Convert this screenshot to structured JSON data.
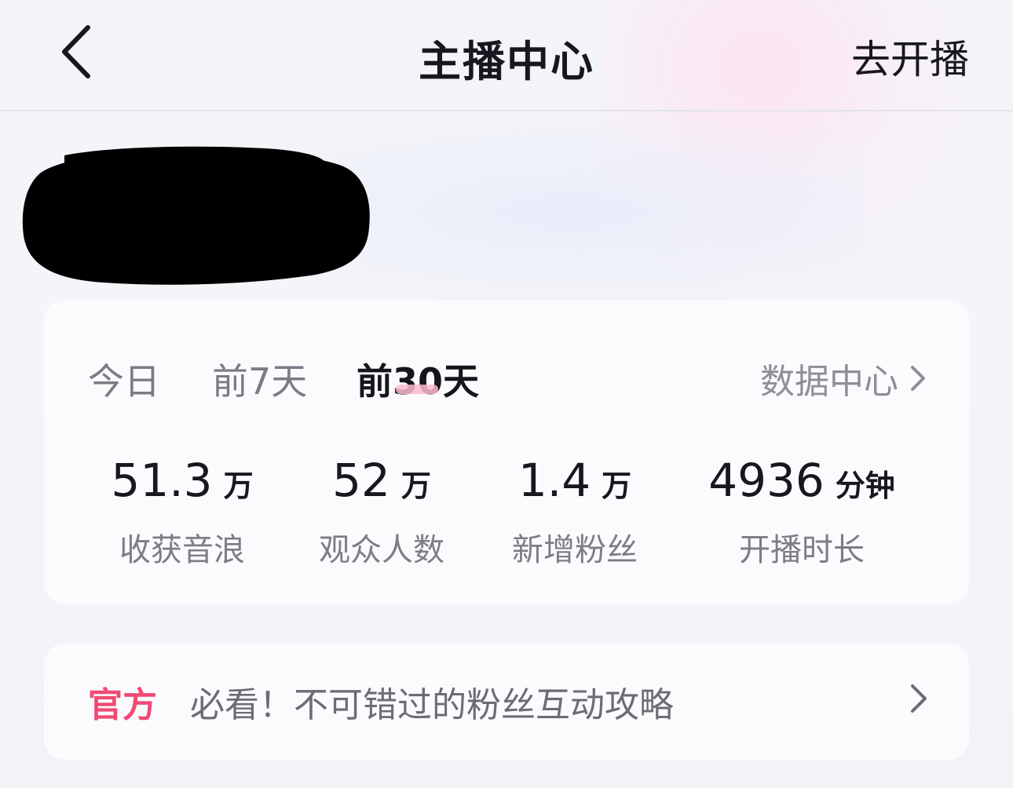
{
  "header": {
    "title": "主播中心",
    "action_label": "去开播"
  },
  "stats": {
    "tabs": [
      {
        "label": "今日",
        "active": false
      },
      {
        "label": "前7天",
        "active": false
      },
      {
        "label": "前30天",
        "active": true
      }
    ],
    "data_center_label": "数据中心",
    "items": [
      {
        "value": "51.3",
        "unit": "万",
        "label": "收获音浪"
      },
      {
        "value": "52",
        "unit": "万",
        "label": "观众人数"
      },
      {
        "value": "1.4",
        "unit": "万",
        "label": "新增粉丝"
      },
      {
        "value": "4936",
        "unit": "分钟",
        "label": "开播时长"
      }
    ]
  },
  "notice": {
    "tag": "官方",
    "text": "必看！不可错过的粉丝互动攻略"
  },
  "colors": {
    "accent_pink": "#f04a74",
    "tab_underline": "#ffb9cf",
    "text_primary": "#17171f",
    "text_secondary": "#7c7d86"
  }
}
